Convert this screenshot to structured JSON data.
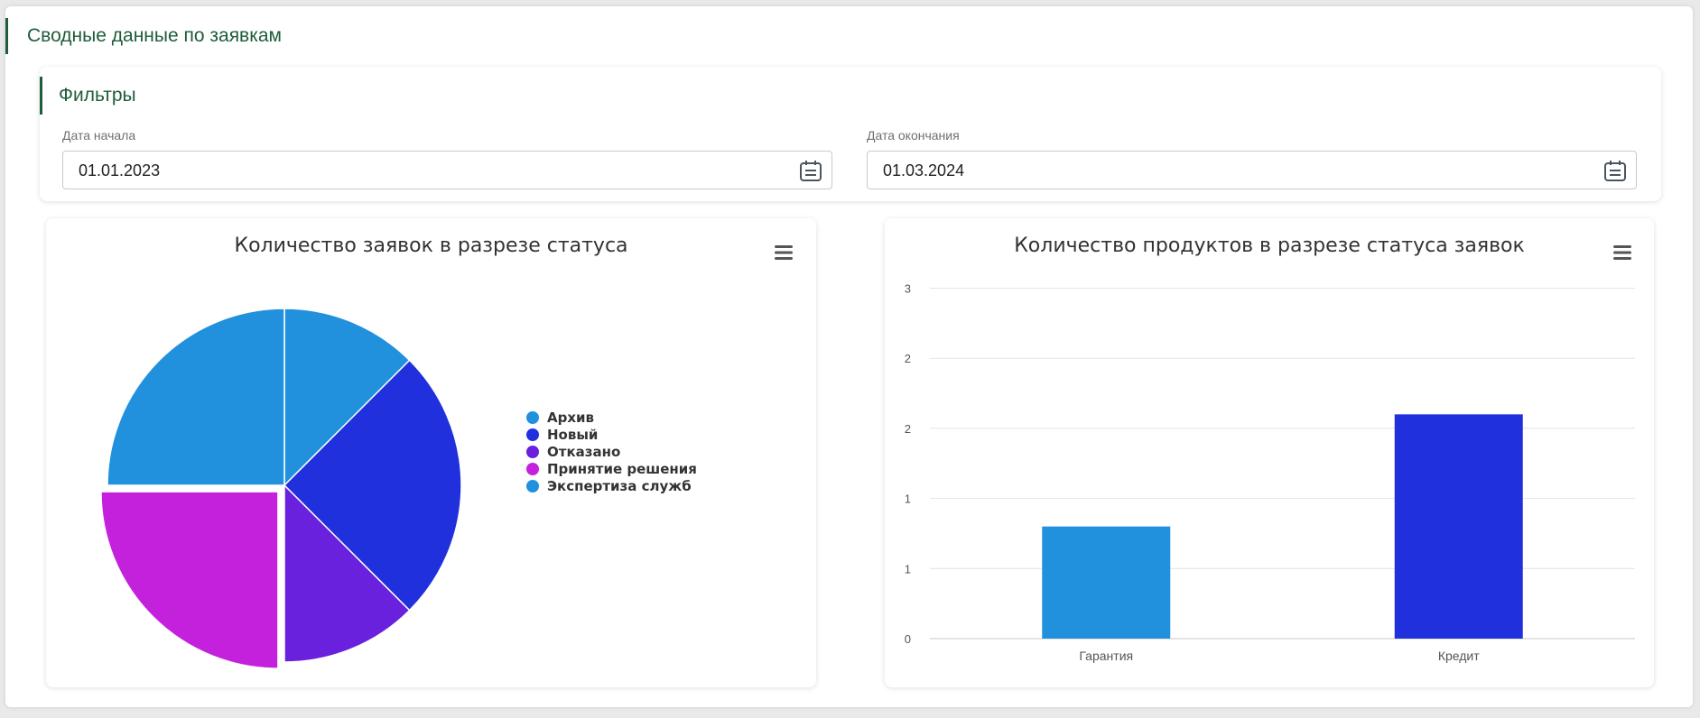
{
  "page": {
    "title": "Сводные данные по заявкам"
  },
  "filters": {
    "title": "Фильтры",
    "start": {
      "label": "Дата начала",
      "value": "01.01.2023"
    },
    "end": {
      "label": "Дата окончания",
      "value": "01.03.2024"
    }
  },
  "colors": {
    "accent": "#1f5c3a",
    "archive": "#2190dd",
    "new": "#2130dd",
    "rejected": "#6921dd",
    "decision": "#c421dd",
    "expertise": "#2190dd"
  },
  "chart_data": [
    {
      "type": "pie",
      "title": "Количество заявок в разрезе статуса",
      "legend_position": "right",
      "slices": [
        {
          "label": "Архив",
          "value": 1,
          "color": "#2190dd"
        },
        {
          "label": "Новый",
          "value": 2,
          "color": "#2130dd"
        },
        {
          "label": "Отказано",
          "value": 1,
          "color": "#6921dd"
        },
        {
          "label": "Принятие решения",
          "value": 2,
          "color": "#c421dd",
          "exploded": true
        },
        {
          "label": "Экспертиза служб",
          "value": 2,
          "color": "#2190dd"
        }
      ]
    },
    {
      "type": "bar",
      "title": "Количество продуктов в разрезе статуса заявок",
      "categories": [
        "Гарантия",
        "Кредит"
      ],
      "values": [
        1,
        2
      ],
      "colors": [
        "#2190dd",
        "#2130dd"
      ],
      "yticks": [
        "0",
        "1",
        "1",
        "2",
        "2",
        "3"
      ],
      "ylim": [
        0,
        2.5
      ],
      "grid": true
    }
  ]
}
